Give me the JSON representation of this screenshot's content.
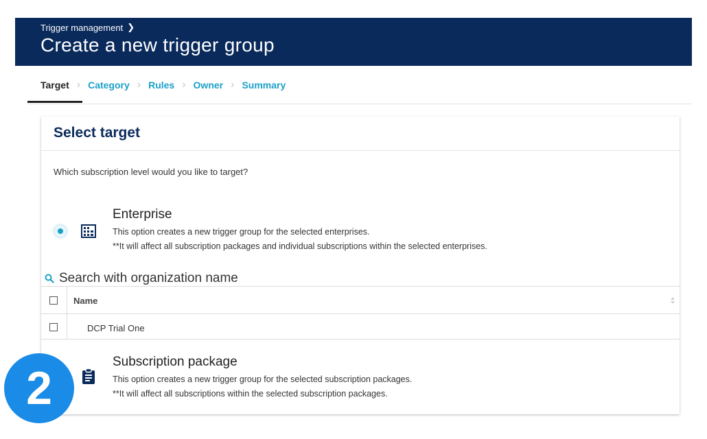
{
  "header": {
    "breadcrumb": "Trigger management",
    "title": "Create a new trigger group"
  },
  "stepper": {
    "steps": [
      "Target",
      "Category",
      "Rules",
      "Owner",
      "Summary"
    ],
    "active_index": 0
  },
  "panel": {
    "title": "Select target",
    "question": "Which subscription level would you like to target?",
    "options": [
      {
        "title": "Enterprise",
        "desc1": "This option creates a new trigger group for the selected enterprises.",
        "desc2": "**It will affect all subscription packages and individual subscriptions within the selected enterprises.",
        "icon": "building-icon",
        "selected": true
      },
      {
        "title": "Subscription package",
        "desc1": "This option creates a new trigger group for the selected subscription packages.",
        "desc2": "**It will affect all subscriptions within the selected subscription packages.",
        "icon": "clipboard-icon",
        "selected": false
      }
    ]
  },
  "search": {
    "placeholder": "Search with organization name"
  },
  "table": {
    "columns": [
      "Name"
    ],
    "rows": [
      {
        "name": "DCP Trial One"
      }
    ]
  },
  "badge": {
    "number": "2"
  },
  "colors": {
    "header_bg": "#0a2a5c",
    "accent": "#1aa0c8",
    "badge": "#1a8be6"
  }
}
